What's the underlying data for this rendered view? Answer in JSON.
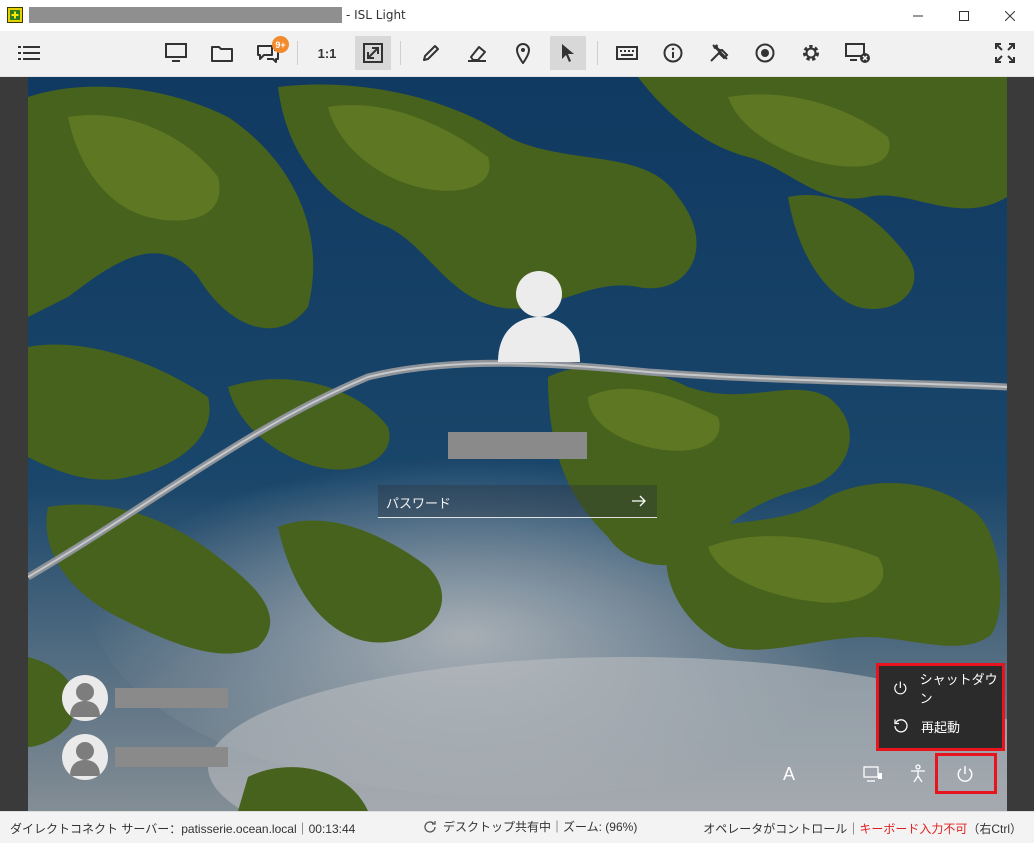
{
  "window": {
    "title": "- ISL Light"
  },
  "toolbar": {
    "buttons": [
      {
        "name": "menu-icon"
      },
      {
        "name": "monitor-icon"
      },
      {
        "name": "folder-icon"
      },
      {
        "name": "chat-icon",
        "badge": "9+"
      },
      {
        "name": "ratio-button",
        "label": "1:1"
      },
      {
        "name": "fit-screen-icon"
      },
      {
        "name": "pencil-icon"
      },
      {
        "name": "eraser-icon"
      },
      {
        "name": "pin-icon"
      },
      {
        "name": "pointer-icon"
      },
      {
        "name": "keyboard-icon"
      },
      {
        "name": "info-icon"
      },
      {
        "name": "tools-icon"
      },
      {
        "name": "record-icon"
      },
      {
        "name": "gear-icon"
      },
      {
        "name": "disconnect-screen-icon"
      },
      {
        "name": "fullscreen-icon"
      }
    ]
  },
  "login": {
    "password_placeholder": "パスワード"
  },
  "power_menu": {
    "shutdown": "シャットダウン",
    "restart": "再起動"
  },
  "tray": {
    "ime_label": "A"
  },
  "status": {
    "left": "ダイレクトコネクト サーバー：patisserie.ocean.local｜00:13:44",
    "center": "デスクトップ共有中｜ズーム: (96%)",
    "right_normal": "オペレータがコントロール｜",
    "right_warn": "キーボード入力不可",
    "right_tail": "（右Ctrl）"
  },
  "colors": {
    "accent_orange": "#f28a2e",
    "highlight_red": "#e8141d",
    "warn_text": "#e02020"
  }
}
